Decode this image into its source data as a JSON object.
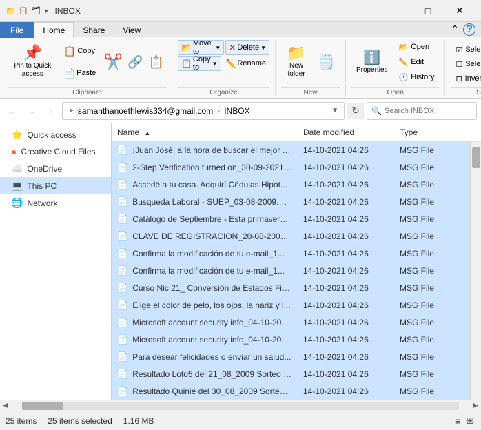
{
  "titlebar": {
    "title": "INBOX",
    "icons": [
      "📁",
      "📋",
      "🗂️"
    ],
    "controls": [
      "—",
      "□",
      "✕"
    ]
  },
  "ribbon": {
    "tabs": [
      "File",
      "Home",
      "Share",
      "View"
    ],
    "active_tab": "Home",
    "groups": {
      "clipboard": {
        "label": "Clipboard",
        "pin_label": "Pin to Quick\naccess",
        "copy_label": "Copy",
        "paste_label": "Paste"
      },
      "organize": {
        "label": "Organize",
        "move_to_label": "Move to",
        "copy_to_label": "Copy to",
        "delete_label": "Delete",
        "rename_label": "Rename"
      },
      "new": {
        "label": "New",
        "new_folder_label": "New\nfolder"
      },
      "open": {
        "label": "Open",
        "properties_label": "Properties"
      },
      "select": {
        "label": "Select",
        "select_all": "Select all",
        "select_none": "Select none",
        "invert_selection": "Invert selection"
      }
    }
  },
  "addressbar": {
    "path_prefix": "samanthanoethlewis334@gmail.com",
    "path_suffix": "INBOX",
    "search_placeholder": "Search INBOX",
    "separator": "›"
  },
  "sidebar": {
    "items": [
      {
        "id": "quick-access",
        "label": "Quick access",
        "icon": "⭐"
      },
      {
        "id": "creative-cloud",
        "label": "Creative Cloud Files",
        "icon": "🔴"
      },
      {
        "id": "onedrive",
        "label": "OneDrive",
        "icon": "☁️"
      },
      {
        "id": "this-pc",
        "label": "This PC",
        "icon": "💻",
        "active": true
      },
      {
        "id": "network",
        "label": "Network",
        "icon": "🌐"
      }
    ]
  },
  "filelist": {
    "columns": [
      {
        "id": "name",
        "label": "Name"
      },
      {
        "id": "date",
        "label": "Date modified"
      },
      {
        "id": "type",
        "label": "Type"
      }
    ],
    "files": [
      {
        "name": "¡Juan José, a la hora de buscar el mejor pr...",
        "date": "14-10-2021 04:26",
        "type": "MSG File",
        "selected": true
      },
      {
        "name": "2-Step Verification turned on_30-09-2021....",
        "date": "14-10-2021 04:26",
        "type": "MSG File",
        "selected": true
      },
      {
        "name": "Accedé a tu casa.  Adquirí Cédulas Hipot...",
        "date": "14-10-2021 04:26",
        "type": "MSG File",
        "selected": true
      },
      {
        "name": "Busqueda Laboral - SUEP_03-08-2009.msg",
        "date": "14-10-2021 04:26",
        "type": "MSG File",
        "selected": true
      },
      {
        "name": "Catálogo de Septiembre - Esta primavera....",
        "date": "14-10-2021 04:26",
        "type": "MSG File",
        "selected": true
      },
      {
        "name": "CLAVE DE REGISTRACION_20-08-2009.msg",
        "date": "14-10-2021 04:26",
        "type": "MSG File",
        "selected": true
      },
      {
        "name": "Confirma la modificación de tu e-mail_1...",
        "date": "14-10-2021 04:26",
        "type": "MSG File",
        "selected": true
      },
      {
        "name": "Confirma la modificación de tu e-mail_1...",
        "date": "14-10-2021 04:26",
        "type": "MSG File",
        "selected": true
      },
      {
        "name": "Curso Nic 21_ Conversión de Estados Fin....",
        "date": "14-10-2021 04:26",
        "type": "MSG File",
        "selected": true
      },
      {
        "name": "Elige el color de pelo, los ojos, la nariz y l...",
        "date": "14-10-2021 04:26",
        "type": "MSG File",
        "selected": true
      },
      {
        "name": "Microsoft account security info_04-10-20...",
        "date": "14-10-2021 04:26",
        "type": "MSG File",
        "selected": true
      },
      {
        "name": "Microsoft account security info_04-10-20...",
        "date": "14-10-2021 04:26",
        "type": "MSG File",
        "selected": true
      },
      {
        "name": "Para desear felicidades o enviar un salud...",
        "date": "14-10-2021 04:26",
        "type": "MSG File",
        "selected": true
      },
      {
        "name": "Resultado Loto5 del 21_08_2009 Sorteo N...",
        "date": "14-10-2021 04:26",
        "type": "MSG File",
        "selected": true
      },
      {
        "name": "Resultado Quinié del 30_08_2009 Sorteo ...",
        "date": "14-10-2021 04:26",
        "type": "MSG File",
        "selected": true
      }
    ]
  },
  "statusbar": {
    "item_count": "25 items",
    "selected_count": "25 items selected",
    "size": "1.16 MB"
  }
}
